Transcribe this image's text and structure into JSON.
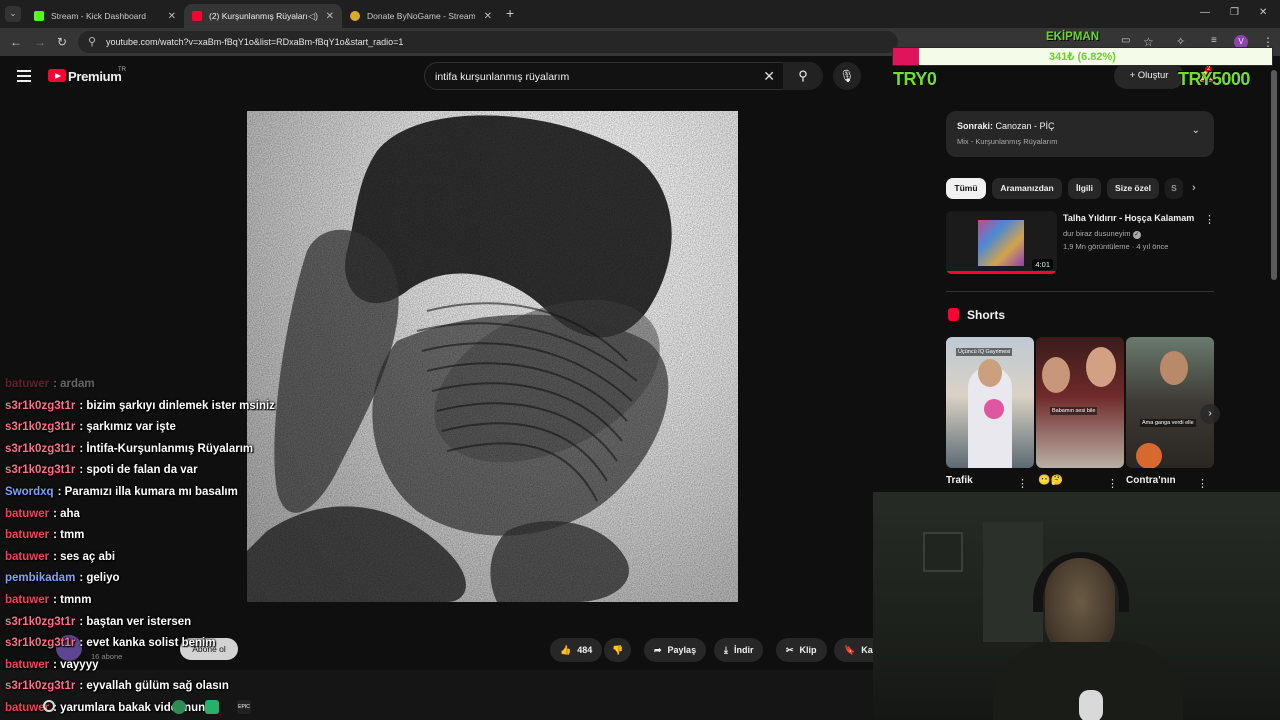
{
  "browser": {
    "tabs": [
      {
        "title": "Stream - Kick Dashboard",
        "favicon_color": "#53fc18"
      },
      {
        "title": "(2) Kurşunlanmış Rüyaları",
        "favicon_color": "#ff0033"
      },
      {
        "title": "Donate ByNoGame - Streamer",
        "favicon_color": "#d9a82c"
      }
    ],
    "url": "youtube.com/watch?v=xaBm-fBqY1o&list=RDxaBm-fBqY1o&start_radio=1",
    "profile_initial": "V"
  },
  "youtube": {
    "brand": "Premium",
    "region": "TR",
    "search_query": "intifa kurşunlanmış rüyalarım",
    "create_label": "Oluştur",
    "notification_count": "2",
    "subscribe_label": "Abone ol",
    "subscriber_count": "16 abone",
    "actions": {
      "likes": "484",
      "share": "Paylaş",
      "download": "İndir",
      "clip": "Klip",
      "save": "Ka"
    },
    "next": {
      "label": "Sonraki:",
      "title": "Canozan - PİÇ",
      "subtitle": "Mix - Kurşunlanmış Rüyalarım"
    },
    "chips": [
      "Tümü",
      "Aramanızdan",
      "İlgili",
      "Size özel",
      "S"
    ],
    "related": {
      "title": "Talha Yıldırır - Hoşça Kalamam",
      "channel": "dur biraz dusuneyim",
      "meta": "1,9 Mn görüntüleme · 4 yıl önce",
      "duration": "4:01",
      "progress": 0.98
    },
    "shorts_title": "Shorts",
    "shorts": [
      {
        "label": "Trafik",
        "caption": "Üçüncü IQ Gayrimesi"
      },
      {
        "label": "😶🤔",
        "caption": "Babamın sesi bile"
      },
      {
        "label": "Contra'nın",
        "caption": "Ama ganga verdi elle"
      }
    ]
  },
  "chat": [
    {
      "user": "batuwer",
      "msg": "ardam",
      "color": "#ff3b5c"
    },
    {
      "user": "s3r1k0zg3t1r",
      "msg": "bizim şarkıyı dinlemek ister msiniz",
      "color": "#ff6f87"
    },
    {
      "user": "s3r1k0zg3t1r",
      "msg": "şarkımız var işte",
      "color": "#ff6f87"
    },
    {
      "user": "s3r1k0zg3t1r",
      "msg": "İntifa-Kurşunlanmış Rüyalarım",
      "color": "#ff6f87"
    },
    {
      "user": "s3r1k0zg3t1r",
      "msg": "spoti de falan da var",
      "color": "#ff6f87"
    },
    {
      "user": "Swordxq",
      "msg": "Paramızı illa kumara mı basalım",
      "color": "#7aa4ff"
    },
    {
      "user": "batuwer",
      "msg": "aha",
      "color": "#ff3b5c"
    },
    {
      "user": "batuwer",
      "msg": "tmm",
      "color": "#ff3b5c"
    },
    {
      "user": "batuwer",
      "msg": "ses aç abi",
      "color": "#ff3b5c"
    },
    {
      "user": "pembikadam",
      "msg": "geliyo",
      "color": "#7aa4ff"
    },
    {
      "user": "batuwer",
      "msg": "tmnm",
      "color": "#ff3b5c"
    },
    {
      "user": "s3r1k0zg3t1r",
      "msg": "baştan ver istersen",
      "color": "#ff6f87"
    },
    {
      "user": "s3r1k0zg3t1r",
      "msg": "evet kanka solist benim",
      "color": "#ff6f87"
    },
    {
      "user": "batuwer",
      "msg": "vayyyy",
      "color": "#ff3b5c"
    },
    {
      "user": "s3r1k0zg3t1r",
      "msg": "eyvallah gülüm sağ olasın",
      "color": "#ff6f87"
    },
    {
      "user": "batuwer",
      "msg": "yarumlara bakak videonun",
      "color": "#ff3b5c"
    }
  ],
  "overlay": {
    "title": "EKİPMAN",
    "progress_text": "341₺ (6.82%)",
    "progress_fraction": 0.0682,
    "goal_start": "TRY0",
    "goal_end": "TRY5000"
  }
}
